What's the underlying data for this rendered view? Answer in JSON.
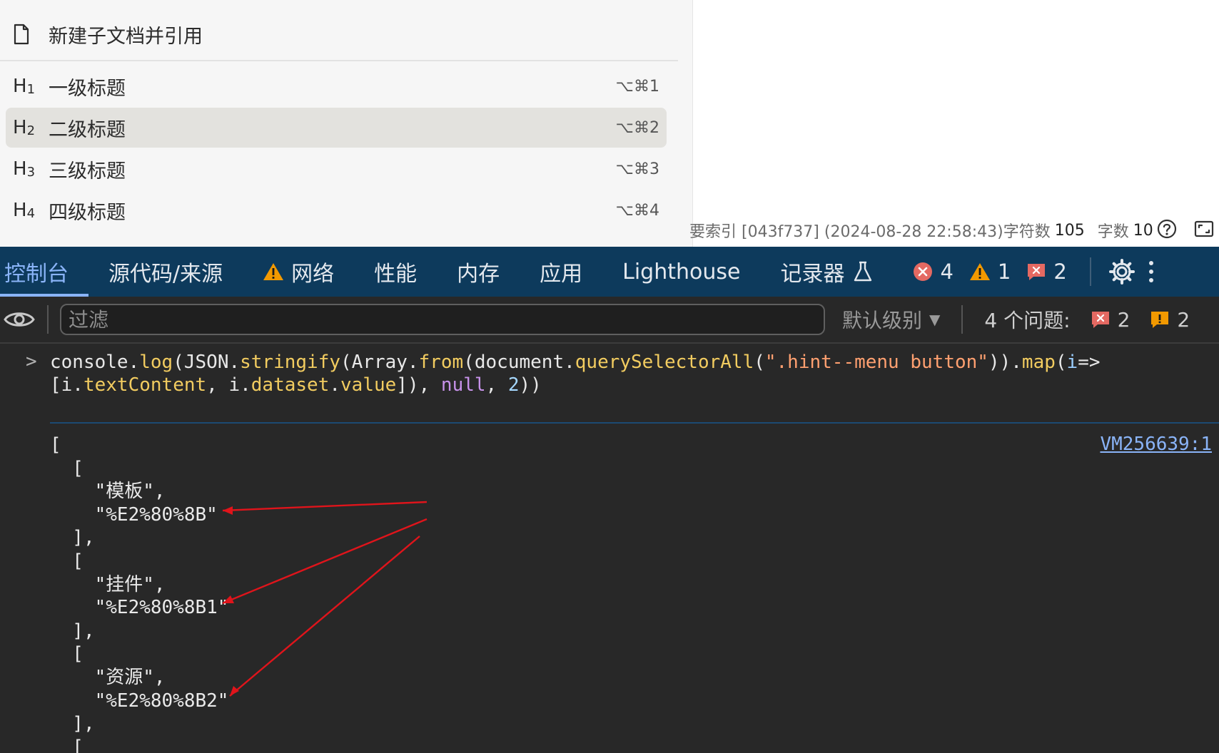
{
  "menu": {
    "items": [
      {
        "icon": "document-icon",
        "label": "新建子文档并引用"
      },
      {
        "heading": "H",
        "level": "1",
        "label": "一级标题",
        "shortcut": "⌥⌘1"
      },
      {
        "heading": "H",
        "level": "2",
        "label": "二级标题",
        "shortcut": "⌥⌘2",
        "active": true
      },
      {
        "heading": "H",
        "level": "3",
        "label": "三级标题",
        "shortcut": "⌥⌘3"
      },
      {
        "heading": "H",
        "level": "4",
        "label": "四级标题",
        "shortcut": "⌥⌘4"
      }
    ]
  },
  "status_bar": {
    "text": "要索引 [043f737] (2024-08-28 22:58:43)",
    "char_label": "字符数",
    "char_count": "105",
    "word_label": "字数",
    "word_count": "10"
  },
  "devtools": {
    "tabs": [
      "控制台",
      "源代码/来源",
      "网络",
      "性能",
      "内存",
      "应用",
      "Lighthouse",
      "记录器"
    ],
    "active_tab": "控制台",
    "status": {
      "errors": "4",
      "warnings": "1",
      "issues": "2"
    },
    "filter": {
      "placeholder": "过滤",
      "level": "默认级别"
    },
    "issues_summary": {
      "label": "4 个问题:",
      "errors": "2",
      "warnings": "2"
    },
    "console": {
      "command": {
        "line1": [
          {
            "t": "obj",
            "v": "console."
          },
          {
            "t": "fn",
            "v": "log"
          },
          {
            "t": "obj",
            "v": "(JSON."
          },
          {
            "t": "fn",
            "v": "stringify"
          },
          {
            "t": "obj",
            "v": "(Array."
          },
          {
            "t": "fn",
            "v": "from"
          },
          {
            "t": "obj",
            "v": "(document."
          },
          {
            "t": "fn",
            "v": "querySelectorAll"
          },
          {
            "t": "obj",
            "v": "("
          },
          {
            "t": "str",
            "v": "\".hint--menu button\""
          },
          {
            "t": "obj",
            "v": "))."
          },
          {
            "t": "fn",
            "v": "map"
          },
          {
            "t": "obj",
            "v": "("
          },
          {
            "t": "param",
            "v": "i"
          },
          {
            "t": "obj",
            "v": "=>"
          }
        ],
        "line2": [
          {
            "t": "obj",
            "v": "[i."
          },
          {
            "t": "fn",
            "v": "textContent"
          },
          {
            "t": "obj",
            "v": ", i."
          },
          {
            "t": "fn",
            "v": "dataset"
          },
          {
            "t": "obj",
            "v": "."
          },
          {
            "t": "fn",
            "v": "value"
          },
          {
            "t": "obj",
            "v": "]), "
          },
          {
            "t": "kw",
            "v": "null"
          },
          {
            "t": "obj",
            "v": ", "
          },
          {
            "t": "num",
            "v": "2"
          },
          {
            "t": "obj",
            "v": "))"
          }
        ]
      },
      "source_link": "VM256639:1",
      "output_lines": [
        "[",
        "  [",
        "    \"模板\",",
        "    \"%E2%80%8B\"",
        "  ],",
        "  [",
        "    \"挂件\",",
        "    \"%E2%80%8B1\"",
        "  ],",
        "  [",
        "    \"资源\",",
        "    \"%E2%80%8B2\"",
        "  ],",
        "  ["
      ]
    },
    "annotation_color": "#e0141b"
  }
}
